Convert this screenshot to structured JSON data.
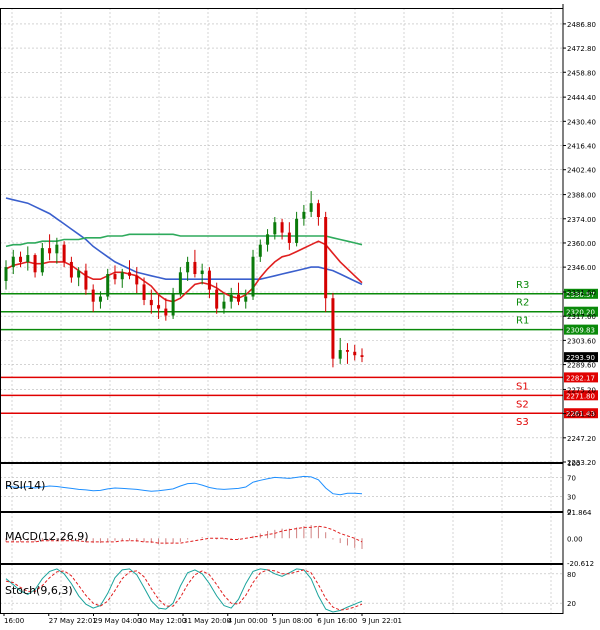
{
  "colors": {
    "background": "#ffffff",
    "grid": "#b9b9b9",
    "axis": "#000000",
    "bull_candle": "#0a7a0a",
    "bear_candle": "#d40000",
    "support": "#e00000",
    "resistance": "#0a8a0a",
    "ma_blue": "#3a5fcd",
    "ma_green": "#2eaa5c",
    "ma_red": "#e02020",
    "rsi_line": "#1e8fff",
    "macd_hist": "#d08080",
    "macd_signal": "#e02020",
    "stoch_main": "#1aa39c",
    "stoch_signal": "#e02020",
    "price_tag_bg": "#000000",
    "price_tag_text": "#ffffff"
  },
  "chart_data": [
    {
      "type": "candlestick",
      "name": "main",
      "ylim": [
        2233.2,
        2496.0
      ],
      "y_ticks": [
        "2486.80",
        "2472.80",
        "2458.80",
        "2444.40",
        "2430.40",
        "2416.40",
        "2402.40",
        "2388.00",
        "2374.00",
        "2360.00",
        "2346.00",
        "2331.60",
        "2317.60",
        "2303.60",
        "2289.60",
        "2275.20",
        "2261.20",
        "2247.20",
        "2233.20"
      ],
      "x_labels": [
        "16:00",
        "27 May 22:01",
        "29 May 04:00",
        "30 May 12:00",
        "31 May 20:00",
        "4 Jun 00:00",
        "5 Jun 08:00",
        "6 Jun 16:00",
        "9 Jun 22:01"
      ],
      "candles": [
        [
          2338,
          2350,
          2333,
          2346
        ],
        [
          2346,
          2356,
          2342,
          2352
        ],
        [
          2352,
          2355,
          2346,
          2349
        ],
        [
          2349,
          2358,
          2344,
          2353
        ],
        [
          2353,
          2354,
          2340,
          2343
        ],
        [
          2343,
          2360,
          2341,
          2357
        ],
        [
          2357,
          2365,
          2350,
          2354
        ],
        [
          2354,
          2363,
          2348,
          2359
        ],
        [
          2359,
          2361,
          2346,
          2349
        ],
        [
          2349,
          2352,
          2337,
          2340
        ],
        [
          2340,
          2346,
          2335,
          2344
        ],
        [
          2344,
          2348,
          2330,
          2333
        ],
        [
          2333,
          2336,
          2320,
          2326
        ],
        [
          2326,
          2332,
          2322,
          2329
        ],
        [
          2329,
          2345,
          2327,
          2342
        ],
        [
          2342,
          2347,
          2336,
          2339
        ],
        [
          2339,
          2345,
          2334,
          2343
        ],
        [
          2343,
          2350,
          2339,
          2341
        ],
        [
          2341,
          2346,
          2331,
          2336
        ],
        [
          2336,
          2340,
          2324,
          2327
        ],
        [
          2327,
          2333,
          2319,
          2324
        ],
        [
          2324,
          2330,
          2316,
          2322
        ],
        [
          2322,
          2328,
          2315,
          2318
        ],
        [
          2318,
          2334,
          2316,
          2331
        ],
        [
          2331,
          2346,
          2329,
          2343
        ],
        [
          2343,
          2352,
          2338,
          2349
        ],
        [
          2349,
          2356,
          2340,
          2342
        ],
        [
          2342,
          2348,
          2336,
          2344
        ],
        [
          2344,
          2346,
          2328,
          2333
        ],
        [
          2333,
          2337,
          2319,
          2322
        ],
        [
          2322,
          2330,
          2319,
          2326
        ],
        [
          2326,
          2334,
          2322,
          2330
        ],
        [
          2330,
          2337,
          2324,
          2326
        ],
        [
          2326,
          2333,
          2322,
          2329
        ],
        [
          2329,
          2356,
          2327,
          2352
        ],
        [
          2352,
          2362,
          2349,
          2359
        ],
        [
          2359,
          2368,
          2355,
          2365
        ],
        [
          2365,
          2375,
          2362,
          2372
        ],
        [
          2372,
          2374,
          2362,
          2366
        ],
        [
          2366,
          2372,
          2356,
          2360
        ],
        [
          2360,
          2378,
          2358,
          2374
        ],
        [
          2374,
          2382,
          2370,
          2378
        ],
        [
          2378,
          2390,
          2375,
          2383
        ],
        [
          2383,
          2385,
          2370,
          2375
        ],
        [
          2375,
          2378,
          2320,
          2328
        ],
        [
          2328,
          2331,
          2288,
          2293
        ],
        [
          2293,
          2305,
          2290,
          2298
        ],
        [
          2298,
          2302,
          2290,
          2297
        ],
        [
          2297,
          2301,
          2292,
          2295
        ],
        [
          2295,
          2299,
          2291,
          2294
        ]
      ],
      "moving_averages": [
        {
          "color_key": "ma_blue",
          "values": [
            2386,
            2385,
            2384,
            2383,
            2381,
            2379,
            2377,
            2374,
            2371,
            2368,
            2365,
            2362,
            2358,
            2355,
            2352,
            2349,
            2347,
            2345,
            2343,
            2342,
            2341,
            2340,
            2339,
            2339,
            2339,
            2339,
            2339,
            2339,
            2339,
            2339,
            2339,
            2339,
            2339,
            2339,
            2339,
            2339,
            2340,
            2341,
            2342,
            2343,
            2344,
            2345,
            2346,
            2346,
            2345,
            2344,
            2342,
            2340,
            2338,
            2336
          ]
        },
        {
          "color_key": "ma_green",
          "values": [
            2358,
            2359,
            2359,
            2360,
            2360,
            2361,
            2361,
            2361,
            2362,
            2362,
            2362,
            2363,
            2363,
            2363,
            2364,
            2364,
            2364,
            2365,
            2365,
            2365,
            2365,
            2365,
            2365,
            2365,
            2364,
            2364,
            2364,
            2364,
            2364,
            2364,
            2364,
            2364,
            2364,
            2364,
            2364,
            2364,
            2364,
            2364,
            2364,
            2364,
            2364,
            2364,
            2364,
            2364,
            2364,
            2363,
            2362,
            2361,
            2360,
            2359
          ]
        },
        {
          "color_key": "ma_red",
          "values": [
            2345,
            2347,
            2348,
            2349,
            2348,
            2348,
            2349,
            2349,
            2349,
            2347,
            2344,
            2341,
            2339,
            2339,
            2341,
            2343,
            2343,
            2342,
            2341,
            2338,
            2335,
            2330,
            2327,
            2326,
            2328,
            2332,
            2336,
            2337,
            2336,
            2334,
            2331,
            2329,
            2328,
            2330,
            2334,
            2340,
            2345,
            2349,
            2352,
            2353,
            2355,
            2357,
            2359,
            2361,
            2359,
            2354,
            2349,
            2345,
            2341,
            2337
          ]
        }
      ],
      "levels": [
        {
          "label": "R3",
          "value": 2330.57,
          "tag": "2330.57",
          "kind": "resistance"
        },
        {
          "label": "R2",
          "value": 2320.2,
          "tag": "2320.20",
          "kind": "resistance"
        },
        {
          "label": "R1",
          "value": 2309.83,
          "tag": "2309.83",
          "kind": "resistance"
        },
        {
          "label": "S1",
          "value": 2282.17,
          "tag": "2282.17",
          "kind": "support"
        },
        {
          "label": "S2",
          "value": 2271.8,
          "tag": "2271.80",
          "kind": "support"
        },
        {
          "label": "S3",
          "value": 2261.43,
          "tag": "2261.43",
          "kind": "support"
        }
      ],
      "current_price": {
        "value": 2293.9,
        "tag": "2293.90"
      }
    },
    {
      "type": "line",
      "name": "rsi",
      "title": "RSI(14)",
      "ylim": [
        0,
        100
      ],
      "y_ticks": [
        "100",
        "70",
        "30",
        "0"
      ],
      "values": [
        52,
        50,
        49,
        51,
        48,
        50,
        52,
        51,
        49,
        47,
        45,
        44,
        42,
        43,
        46,
        48,
        47,
        46,
        45,
        43,
        41,
        42,
        44,
        46,
        52,
        57,
        58,
        54,
        49,
        46,
        45,
        46,
        47,
        50,
        60,
        64,
        67,
        70,
        69,
        68,
        70,
        72,
        71,
        65,
        48,
        36,
        34,
        37,
        37,
        36
      ]
    },
    {
      "type": "bar",
      "name": "macd",
      "title": "MACD(12,26,9)",
      "ylim": [
        -20.612,
        21.864
      ],
      "y_ticks": [
        "21.864",
        "0.00",
        "-20.612"
      ],
      "histogram": [
        -3,
        -3,
        -3,
        -2,
        -3,
        -2,
        -2,
        -1,
        -2,
        -2,
        -3,
        -3,
        -4,
        -4,
        -3,
        -2,
        -2,
        -2,
        -3,
        -3,
        -4,
        -5,
        -5,
        -4,
        -3,
        -1,
        0,
        1,
        0,
        -1,
        -1,
        -1,
        -1,
        0,
        2,
        4,
        6,
        7,
        8,
        8,
        9,
        10,
        11,
        10,
        5,
        -1,
        -4,
        -6,
        -8,
        -9
      ],
      "signal": [
        -3,
        -3,
        -3,
        -3,
        -3,
        -2,
        -2,
        -2,
        -2,
        -2,
        -2,
        -3,
        -3,
        -3,
        -3,
        -3,
        -2,
        -2,
        -2,
        -3,
        -3,
        -4,
        -4,
        -4,
        -4,
        -3,
        -2,
        -1,
        0,
        0,
        0,
        -1,
        -1,
        0,
        1,
        2,
        3,
        4,
        6,
        7,
        8,
        9,
        9,
        10,
        9,
        7,
        4,
        2,
        0,
        -3
      ]
    },
    {
      "type": "line",
      "name": "stoch",
      "title": "Stoch(9,6,3)",
      "ylim": [
        0,
        100
      ],
      "y_ticks": [
        "80",
        "20"
      ],
      "main": [
        70,
        58,
        45,
        38,
        48,
        70,
        85,
        90,
        80,
        60,
        35,
        18,
        10,
        15,
        40,
        72,
        88,
        90,
        78,
        52,
        25,
        10,
        8,
        20,
        55,
        82,
        88,
        80,
        60,
        35,
        15,
        10,
        28,
        60,
        85,
        90,
        88,
        80,
        75,
        82,
        90,
        88,
        70,
        35,
        8,
        2,
        5,
        12,
        18,
        24
      ],
      "signal": [
        65,
        62,
        52,
        44,
        44,
        56,
        72,
        84,
        86,
        76,
        56,
        36,
        20,
        14,
        24,
        46,
        70,
        84,
        86,
        74,
        50,
        28,
        14,
        14,
        32,
        58,
        78,
        86,
        78,
        58,
        36,
        20,
        18,
        36,
        62,
        82,
        88,
        86,
        80,
        80,
        84,
        88,
        82,
        58,
        30,
        12,
        6,
        8,
        12,
        18
      ]
    }
  ]
}
